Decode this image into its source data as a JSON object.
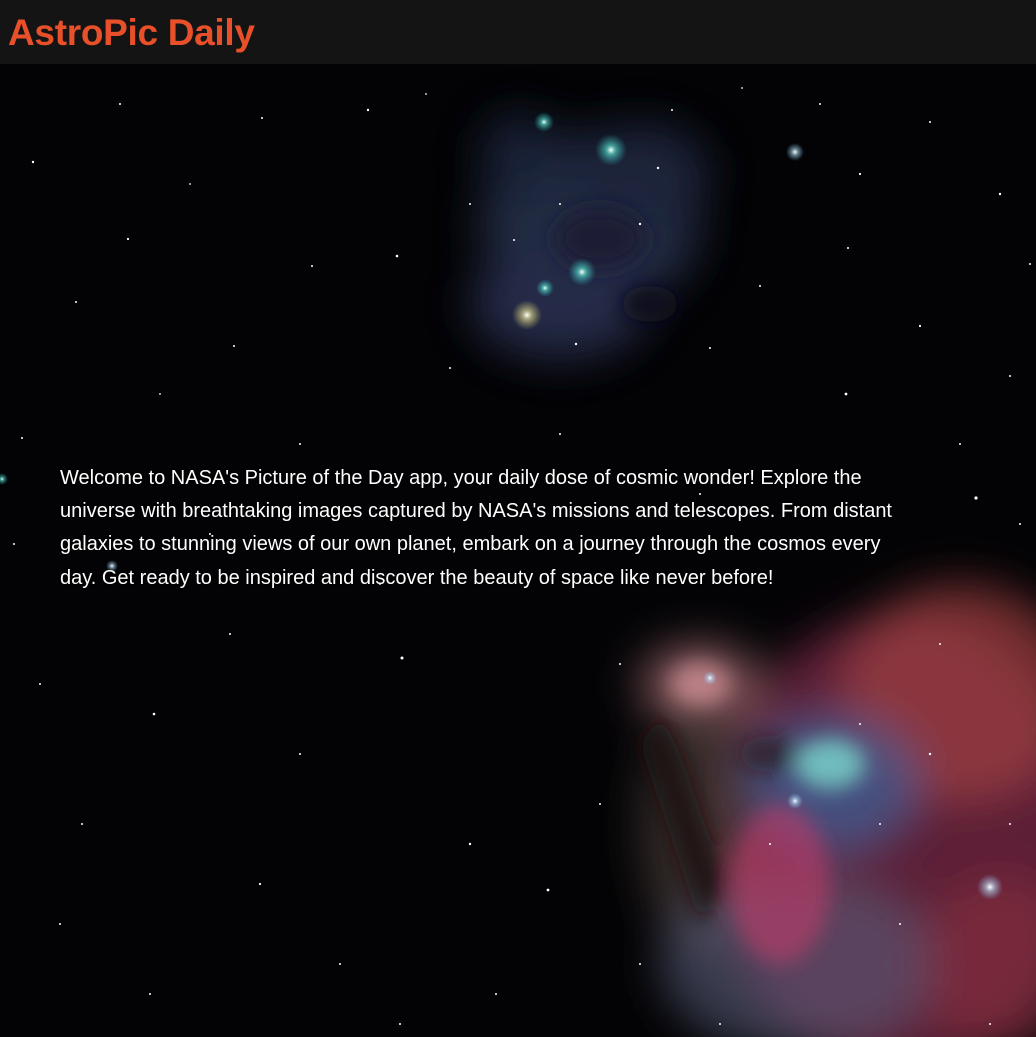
{
  "header": {
    "title": "AstroPic Daily",
    "title_color": "#e8502a",
    "background": "#141414"
  },
  "hero": {
    "background_image": "orion-nebula-starfield",
    "intro_text": "Welcome to NASA's Picture of the Day app, your daily dose of cosmic wonder! Explore the universe with breathtaking images captured by NASA's missions and telescopes. From distant galaxies to stunning views of our own planet, embark on a journey through the cosmos every day. Get ready to be inspired and discover the beauty of space like never before!"
  }
}
